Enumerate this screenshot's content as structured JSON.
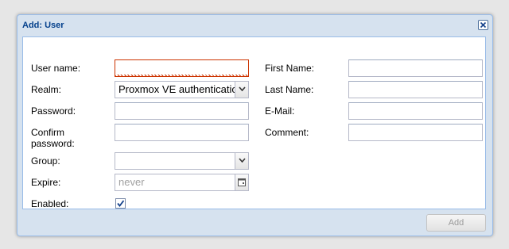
{
  "window": {
    "title": "Add: User"
  },
  "form": {
    "username": {
      "label": "User name:",
      "value": ""
    },
    "realm": {
      "label": "Realm:",
      "value": "Proxmox VE authentication server"
    },
    "password": {
      "label": "Password:",
      "value": ""
    },
    "confirm_password": {
      "label": "Confirm password:",
      "value": ""
    },
    "group": {
      "label": "Group:",
      "value": ""
    },
    "expire": {
      "label": "Expire:",
      "placeholder": "never"
    },
    "enabled": {
      "label": "Enabled:",
      "checked": true
    },
    "first_name": {
      "label": "First Name:",
      "value": ""
    },
    "last_name": {
      "label": "Last Name:",
      "value": ""
    },
    "email": {
      "label": "E-Mail:",
      "value": ""
    },
    "comment": {
      "label": "Comment:",
      "value": ""
    }
  },
  "footer": {
    "add_label": "Add"
  },
  "icons": {
    "close": "close-icon",
    "dropdown": "chevron-down-icon",
    "date_picker": "calendar-icon",
    "checkmark": "checkmark-icon"
  },
  "colors": {
    "title": "#04408c",
    "frame": "#d6e2ef",
    "border": "#99bce8",
    "invalid": "#cc3300"
  }
}
